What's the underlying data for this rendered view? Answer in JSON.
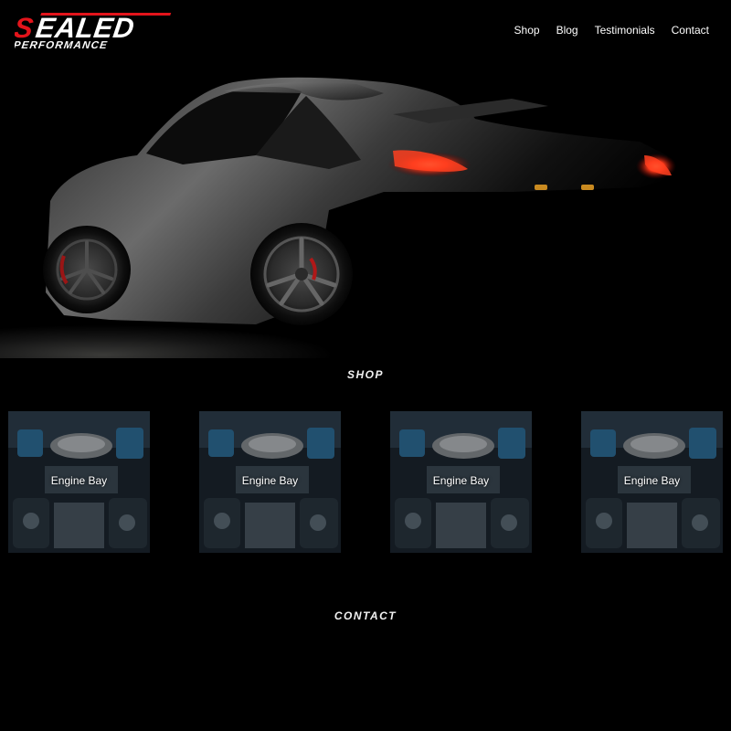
{
  "brand": {
    "logo_line1": "SEALED",
    "logo_line2": "PERFORMANCE",
    "accent_color": "#e3141b"
  },
  "nav": {
    "items": [
      {
        "label": "Shop"
      },
      {
        "label": "Blog"
      },
      {
        "label": "Testimonials"
      },
      {
        "label": "Contact"
      }
    ]
  },
  "hero": {
    "image": "dark-sports-car-rear-taillights"
  },
  "shop": {
    "title": "SHOP",
    "products": [
      {
        "label": "Engine Bay",
        "image": "engine-bay-photo"
      },
      {
        "label": "Engine Bay",
        "image": "engine-bay-photo"
      },
      {
        "label": "Engine Bay",
        "image": "engine-bay-photo"
      },
      {
        "label": "Engine Bay",
        "image": "engine-bay-photo"
      }
    ]
  },
  "contact": {
    "title": "CONTACT"
  }
}
